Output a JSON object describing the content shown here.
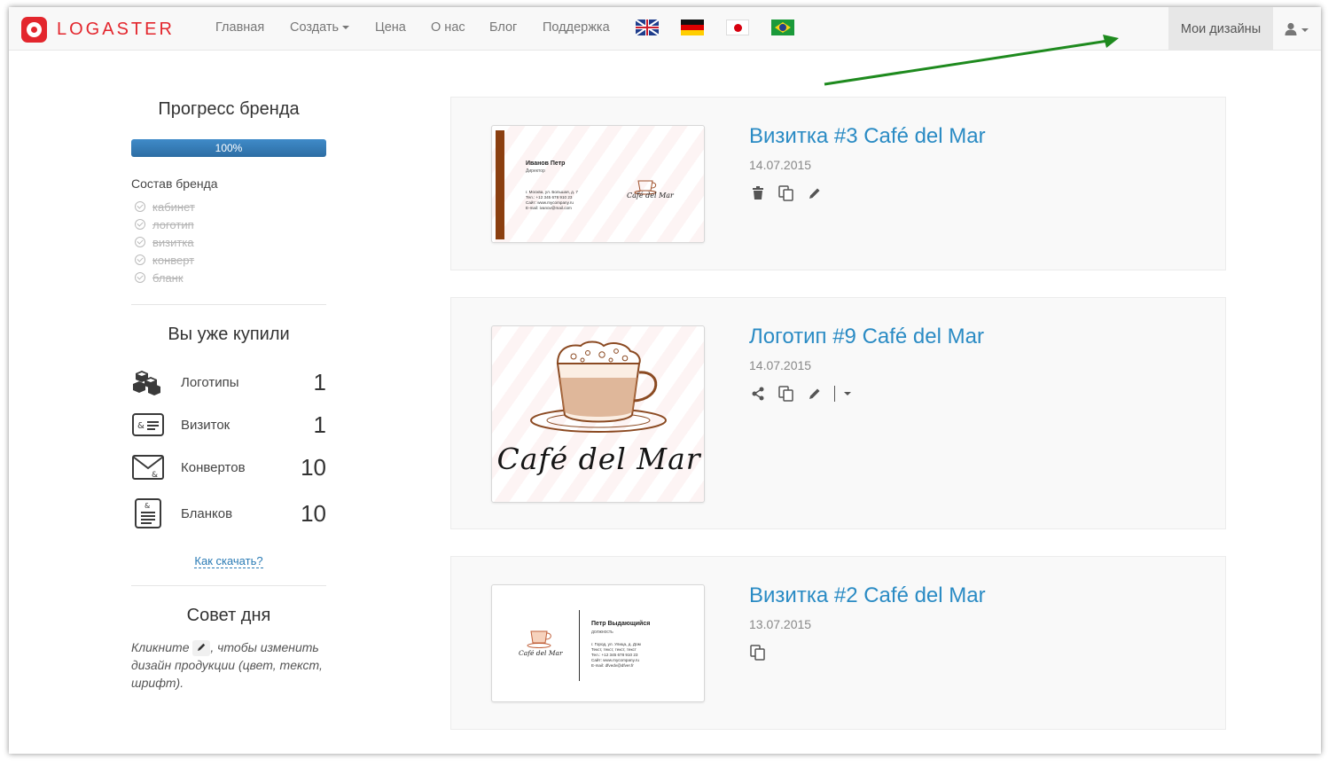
{
  "navbar": {
    "logo_text": "LOGASTER",
    "items": [
      {
        "label": "Главная"
      },
      {
        "label": "Создать"
      },
      {
        "label": "Цена"
      },
      {
        "label": "О нас"
      },
      {
        "label": "Блог"
      },
      {
        "label": "Поддержка"
      }
    ],
    "flags": [
      "uk-flag-icon",
      "germany-flag-icon",
      "japan-flag-icon",
      "brazil-flag-icon"
    ],
    "active_item": "Мои дизайны",
    "user_icon": "user-icon"
  },
  "sidebar": {
    "progress_title": "Прогресс бренда",
    "progress_value": "100%",
    "progress_fraction": 1.0,
    "brand_label": "Состав бренда",
    "brand_items": [
      "кабинет",
      "логотип",
      "визитка",
      "конверт",
      "бланк"
    ],
    "bought_title": "Вы уже купили",
    "bought": [
      {
        "label": "Логотипы",
        "count": "1",
        "icon": "logo-blocks-icon"
      },
      {
        "label": "Визиток",
        "count": "1",
        "icon": "business-card-icon"
      },
      {
        "label": "Конвертов",
        "count": "10",
        "icon": "envelope-icon"
      },
      {
        "label": "Бланков",
        "count": "10",
        "icon": "letterhead-icon"
      }
    ],
    "howto_link": "Как скачать?",
    "tip_title": "Совет дня",
    "tip_before": "Кликните",
    "tip_after": ", чтобы изменить дизайн продукции (цвет, текст, шрифт)."
  },
  "designs": [
    {
      "title": "Визитка #3 Café del Mar",
      "date": "14.07.2015",
      "actions": [
        "trash-icon",
        "copy-icon",
        "pencil-icon"
      ],
      "preview": {
        "name": "Иванов Петр",
        "position": "Директор",
        "lines": [
          "г. Москва, ул. Большая, д. 7",
          "Тел.: +12 345 678 910 23",
          "Сайт: www.mycompany.ru",
          "E-mail: ivanov@mail.com"
        ],
        "logo_text": "Café del Mar"
      }
    },
    {
      "title": "Логотип #9 Café del Mar",
      "date": "14.07.2015",
      "actions": [
        "share-icon",
        "copy-icon",
        "pencil-icon",
        "dropdown-caret-icon"
      ],
      "preview": {
        "logo_text": "Café del Mar"
      }
    },
    {
      "title": "Визитка #2 Café del Mar",
      "date": "13.07.2015",
      "actions": [
        "copy-icon"
      ],
      "preview": {
        "name": "Петр Выдающийся",
        "position": "должность",
        "lines": [
          "г. Город, ул. Улица, д. Дом",
          "Текст, текст, текст, текст",
          "Тел.: +12 345 678 910 23",
          "Сайт: www.mycompany.ru",
          "E-mail: dfvedv@dfver.fr"
        ],
        "logo_text": "Café del Mar"
      }
    }
  ],
  "colors": {
    "brand": "#e3262d",
    "link": "#2a8bc4",
    "progress": "#337ab7",
    "arrow": "#1e8a1e"
  }
}
